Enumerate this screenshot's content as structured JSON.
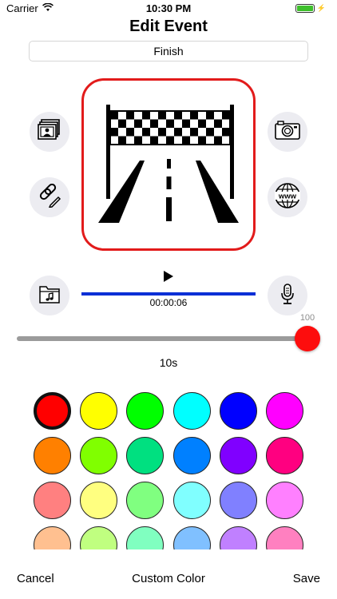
{
  "status": {
    "carrier": "Carrier",
    "time": "10:30 PM"
  },
  "header": {
    "title": "Edit Event"
  },
  "event": {
    "name": "Finish"
  },
  "icons": {
    "photo_library": "photo-library-icon",
    "link": "link-edit-icon",
    "camera": "camera-icon",
    "web": "globe-www-icon",
    "music_folder": "music-folder-icon",
    "microphone": "microphone-icon",
    "play": "play-icon"
  },
  "audio": {
    "time": "00:00:06"
  },
  "slider": {
    "max_label": "100",
    "value": 100,
    "duration_label": "10s"
  },
  "colors": {
    "selected_index": 0,
    "swatches": [
      "#ff0000",
      "#ffff00",
      "#00ff00",
      "#00ffff",
      "#0000ff",
      "#ff00ff",
      "#ff8000",
      "#80ff00",
      "#00e080",
      "#0080ff",
      "#8000ff",
      "#ff0080",
      "#ff8080",
      "#ffff80",
      "#80ff80",
      "#80ffff",
      "#8080ff",
      "#ff80ff",
      "#ffc090",
      "#c0ff80",
      "#80ffc0",
      "#80c0ff",
      "#c080ff",
      "#ff80c0"
    ]
  },
  "toolbar": {
    "cancel": "Cancel",
    "custom_color": "Custom Color",
    "save": "Save"
  },
  "accent": {
    "frame": "#e21b1b",
    "progress": "#0a2fd6",
    "thumb": "#fd0d0d"
  }
}
